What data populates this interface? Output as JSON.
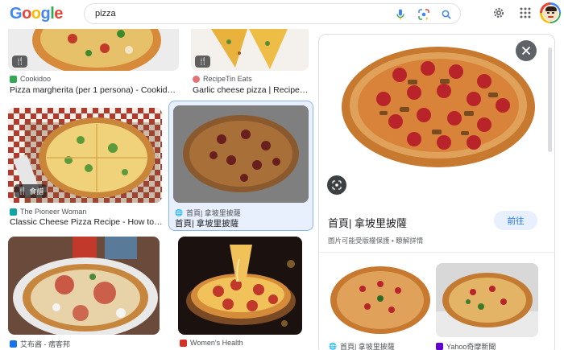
{
  "header": {
    "logo_letters": [
      "G",
      "o",
      "o",
      "g",
      "l",
      "e"
    ],
    "logo_colors": [
      "#4285f4",
      "#ea4335",
      "#fbbc05",
      "#4285f4",
      "#34a853",
      "#ea4335"
    ],
    "search_query": "pizza",
    "icons": [
      "mic-icon",
      "lens-icon",
      "search-icon",
      "settings-icon",
      "apps-icon",
      "avatar"
    ]
  },
  "results": [
    {
      "source": "Cookidoo",
      "title": "Pizza margherita (per 1 persona) - Cookidoo® ...",
      "badge": ""
    },
    {
      "source": "RecipeTin Eats",
      "title": "Garlic cheese pizza | RecipeTin...",
      "badge": ""
    },
    {
      "source": "The Pioneer Woman",
      "title": "Classic Cheese Pizza Recipe - How to Ma...",
      "badge": "食譜"
    },
    {
      "source": "首頁| 拿坡里披薩",
      "title": "首頁| 拿坡里披薩",
      "badge": ""
    },
    {
      "source": "艾布酱 - 痞客邦",
      "title": "",
      "badge": ""
    },
    {
      "source": "Women's Health",
      "title": "",
      "badge": ""
    }
  ],
  "panel": {
    "title": "首頁| 拿坡里披薩",
    "visit_label": "前往",
    "copyright_text": "圖片可能受版權保護",
    "learn_more": "瞭解詳情",
    "related": [
      {
        "source": "首頁| 拿坡里披薩"
      },
      {
        "source": "Yahoo奇摩新聞"
      }
    ]
  },
  "colors": {
    "accent_blue": "#1a73e8",
    "selected_border": "#8ab4f8",
    "selected_bg": "#e8f0fe"
  }
}
